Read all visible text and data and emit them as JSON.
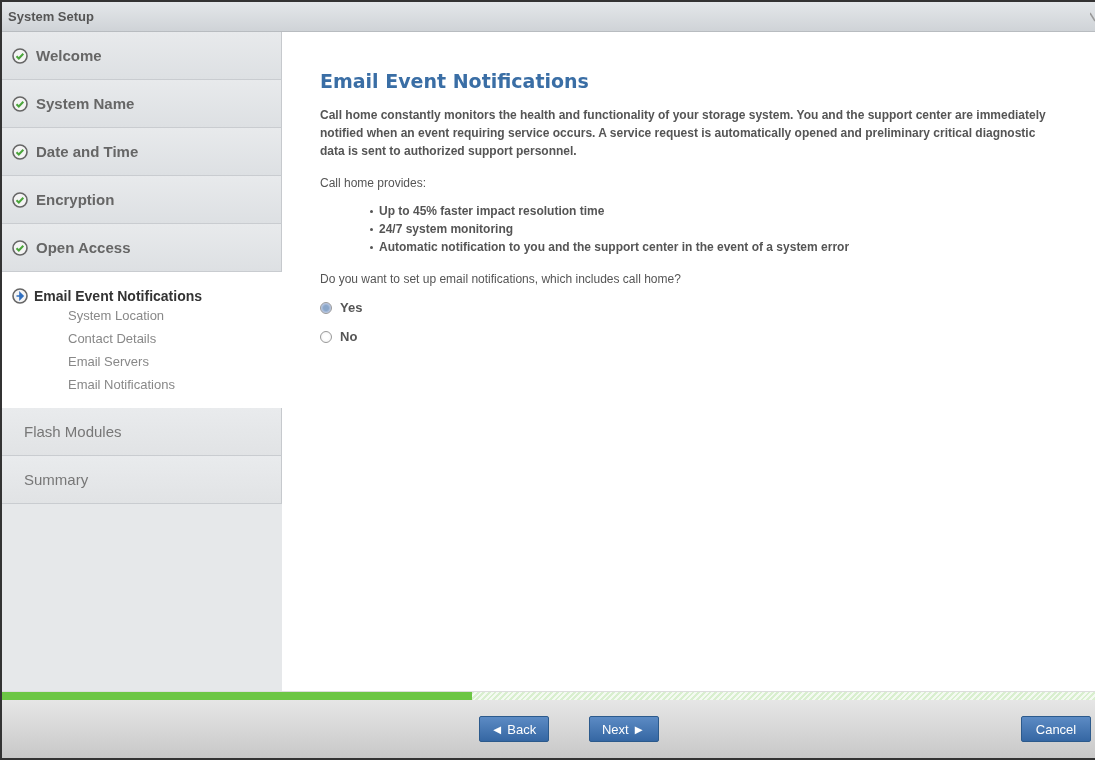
{
  "window": {
    "title": "System Setup"
  },
  "steps": [
    {
      "label": "Welcome",
      "kind": "done"
    },
    {
      "label": "System Name",
      "kind": "done"
    },
    {
      "label": "Date and Time",
      "kind": "done"
    },
    {
      "label": "Encryption",
      "kind": "done"
    },
    {
      "label": "Open Access",
      "kind": "done"
    },
    {
      "label": "Email Event Notifications",
      "kind": "current",
      "children": [
        {
          "label": "System Location"
        },
        {
          "label": "Contact Details"
        },
        {
          "label": "Email Servers"
        },
        {
          "label": "Email Notifications"
        }
      ]
    },
    {
      "label": "Flash Modules",
      "kind": "pending"
    },
    {
      "label": "Summary",
      "kind": "pending"
    }
  ],
  "content": {
    "heading": "Email Event Notifications",
    "intro": "Call home constantly monitors the health and functionality of your storage system. You and the support center are immediately notified when an event requiring service occurs. A service request is automatically opened and preliminary critical diagnostic data is sent to authorized support personnel.",
    "provides_label": "Call home provides:",
    "benefits": [
      "Up to 45% faster impact resolution time",
      "24/7 system monitoring",
      "Automatic notification to you and the support center in the event of a system error"
    ],
    "question": "Do you want to set up email notifications, which includes call home?",
    "options": [
      {
        "label": "Yes",
        "selected": true
      },
      {
        "label": "No",
        "selected": false
      }
    ]
  },
  "progress": {
    "level": 0.43
  },
  "buttons": {
    "back": "◄ Back",
    "next": "Next ►",
    "cancel": "Cancel"
  }
}
